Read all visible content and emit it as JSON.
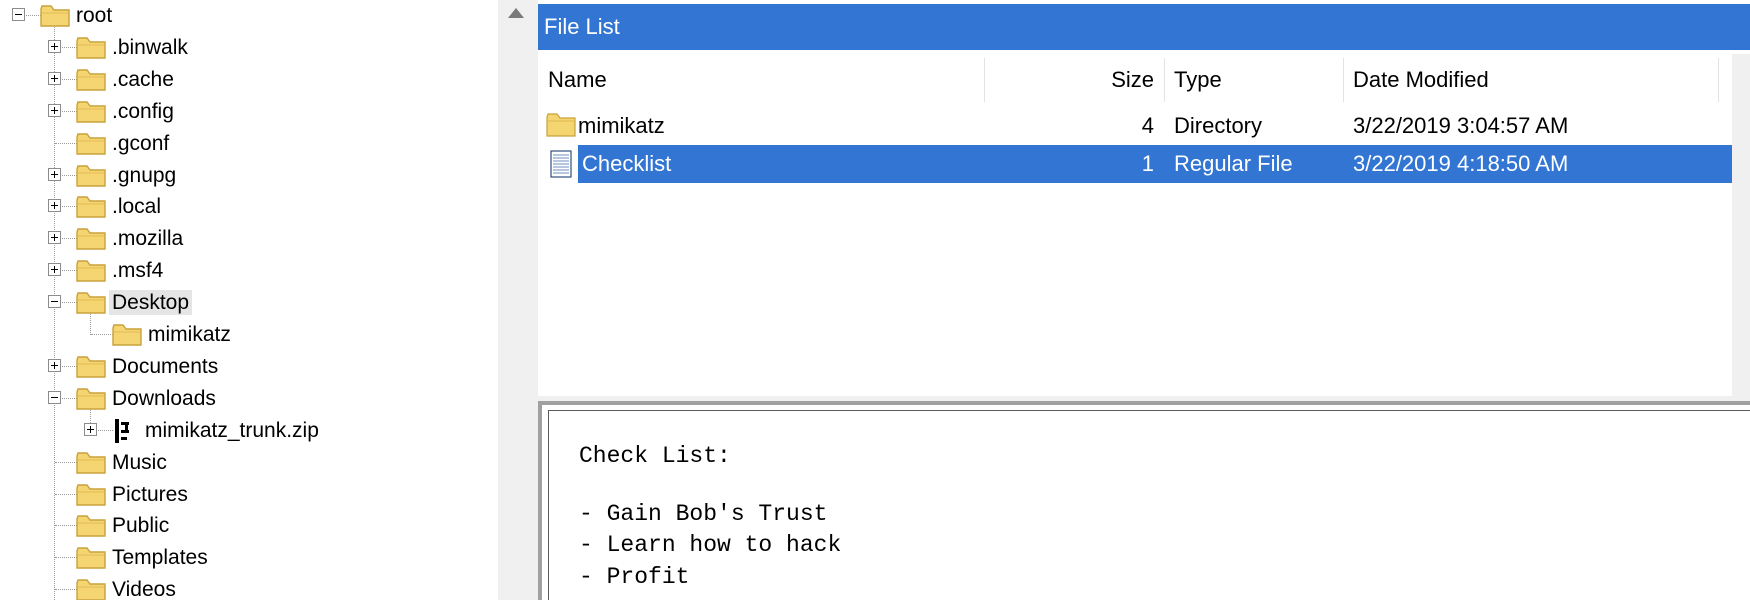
{
  "tree": {
    "items": [
      {
        "label": "root",
        "level": 0,
        "expander": "minus"
      },
      {
        "label": ".binwalk",
        "level": 1,
        "expander": "plus"
      },
      {
        "label": ".cache",
        "level": 1,
        "expander": "plus"
      },
      {
        "label": ".config",
        "level": 1,
        "expander": "plus"
      },
      {
        "label": ".gconf",
        "level": 1,
        "expander": "none"
      },
      {
        "label": ".gnupg",
        "level": 1,
        "expander": "plus"
      },
      {
        "label": ".local",
        "level": 1,
        "expander": "plus"
      },
      {
        "label": ".mozilla",
        "level": 1,
        "expander": "plus"
      },
      {
        "label": ".msf4",
        "level": 1,
        "expander": "plus"
      },
      {
        "label": "Desktop",
        "level": 1,
        "expander": "minus",
        "selected": true
      },
      {
        "label": "mimikatz",
        "level": 2,
        "expander": "none"
      },
      {
        "label": "Documents",
        "level": 1,
        "expander": "plus"
      },
      {
        "label": "Downloads",
        "level": 1,
        "expander": "minus"
      },
      {
        "label": "mimikatz_trunk.zip",
        "level": 2,
        "expander": "plus",
        "icon": "archive"
      },
      {
        "label": "Music",
        "level": 1,
        "expander": "none"
      },
      {
        "label": "Pictures",
        "level": 1,
        "expander": "none"
      },
      {
        "label": "Public",
        "level": 1,
        "expander": "none"
      },
      {
        "label": "Templates",
        "level": 1,
        "expander": "none"
      },
      {
        "label": "Videos",
        "level": 1,
        "expander": "none"
      }
    ]
  },
  "file_list": {
    "title": "File List",
    "columns": {
      "name": "Name",
      "size": "Size",
      "type": "Type",
      "date": "Date Modified"
    },
    "rows": [
      {
        "icon": "folder-icon",
        "name": "mimikatz",
        "size": "4",
        "type": "Directory",
        "date": "3/22/2019 3:04:57 AM",
        "selected": false
      },
      {
        "icon": "text-file-icon",
        "name": "Checklist",
        "size": "1",
        "type": "Regular File",
        "date": "3/22/2019 4:18:50 AM",
        "selected": true
      }
    ]
  },
  "preview": {
    "lines": [
      "Check List:",
      "",
      "- Gain Bob's Trust",
      "- Learn how to hack",
      "- Profit"
    ]
  },
  "colors": {
    "accent": "#3275d2",
    "folder": "#f5d472",
    "folder_border": "#c9a23a"
  }
}
